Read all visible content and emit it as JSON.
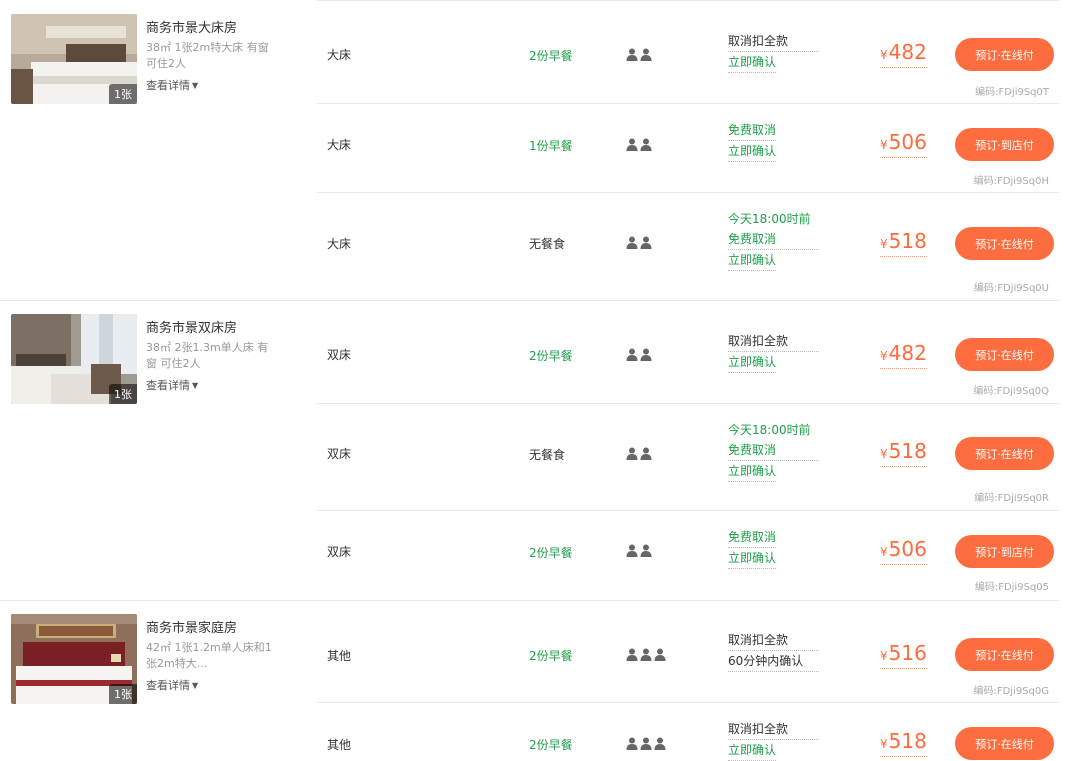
{
  "accent_color": "#fe6d3f",
  "green_color": "#1e9f4a",
  "rooms": [
    {
      "name": "商务市景大床房",
      "desc": "38㎡ 1张2m特大床 有窗 可住2人",
      "more": "查看详情",
      "photo_count": "1张",
      "offers": [
        {
          "bed": "大床",
          "meal": "2份早餐",
          "guests": 2,
          "policy": [
            "取消扣全款",
            "立即确认"
          ],
          "currency": "¥",
          "price": "482",
          "button": "预订·在线付",
          "code": "编码:FDji9Sq0T"
        },
        {
          "bed": "大床",
          "meal": "1份早餐",
          "guests": 2,
          "policy": [
            "免费取消",
            "立即确认"
          ],
          "currency": "¥",
          "price": "506",
          "button": "预订·到店付",
          "code": "编码:FDji9Sq0H"
        },
        {
          "bed": "大床",
          "meal": "无餐食",
          "guests": 2,
          "policy": [
            "今天18:00时前",
            "免费取消",
            "立即确认"
          ],
          "currency": "¥",
          "price": "518",
          "button": "预订·在线付",
          "code": "编码:FDji9Sq0U"
        }
      ]
    },
    {
      "name": "商务市景双床房",
      "desc": "38㎡ 2张1.3m单人床 有窗 可住2人",
      "more": "查看详情",
      "photo_count": "1张",
      "offers": [
        {
          "bed": "双床",
          "meal": "2份早餐",
          "guests": 2,
          "policy": [
            "取消扣全款",
            "立即确认"
          ],
          "currency": "¥",
          "price": "482",
          "button": "预订·在线付",
          "code": "编码:FDji9Sq0Q"
        },
        {
          "bed": "双床",
          "meal": "无餐食",
          "guests": 2,
          "policy": [
            "今天18:00时前",
            "免费取消",
            "立即确认"
          ],
          "currency": "¥",
          "price": "518",
          "button": "预订·在线付",
          "code": "编码:FDji9Sq0R"
        },
        {
          "bed": "双床",
          "meal": "2份早餐",
          "guests": 2,
          "policy": [
            "免费取消",
            "立即确认"
          ],
          "currency": "¥",
          "price": "506",
          "button": "预订·到店付",
          "code": "编码:FDji9Sq05"
        }
      ]
    },
    {
      "name": "商务市景家庭房",
      "desc": "42㎡ 1张1.2m单人床和1张2m特大...",
      "more": "查看详情",
      "photo_count": "1张",
      "offers": [
        {
          "bed": "其他",
          "meal": "2份早餐",
          "guests": 3,
          "policy": [
            "取消扣全款",
            "60分钟内确认"
          ],
          "currency": "¥",
          "price": "516",
          "button": "预订·在线付",
          "code": "编码:FDji9Sq0G"
        },
        {
          "bed": "其他",
          "meal": "2份早餐",
          "guests": 3,
          "policy": [
            "取消扣全款",
            "立即确认"
          ],
          "currency": "¥",
          "price": "518",
          "button": "预订·在线付",
          "code": ""
        }
      ]
    }
  ]
}
